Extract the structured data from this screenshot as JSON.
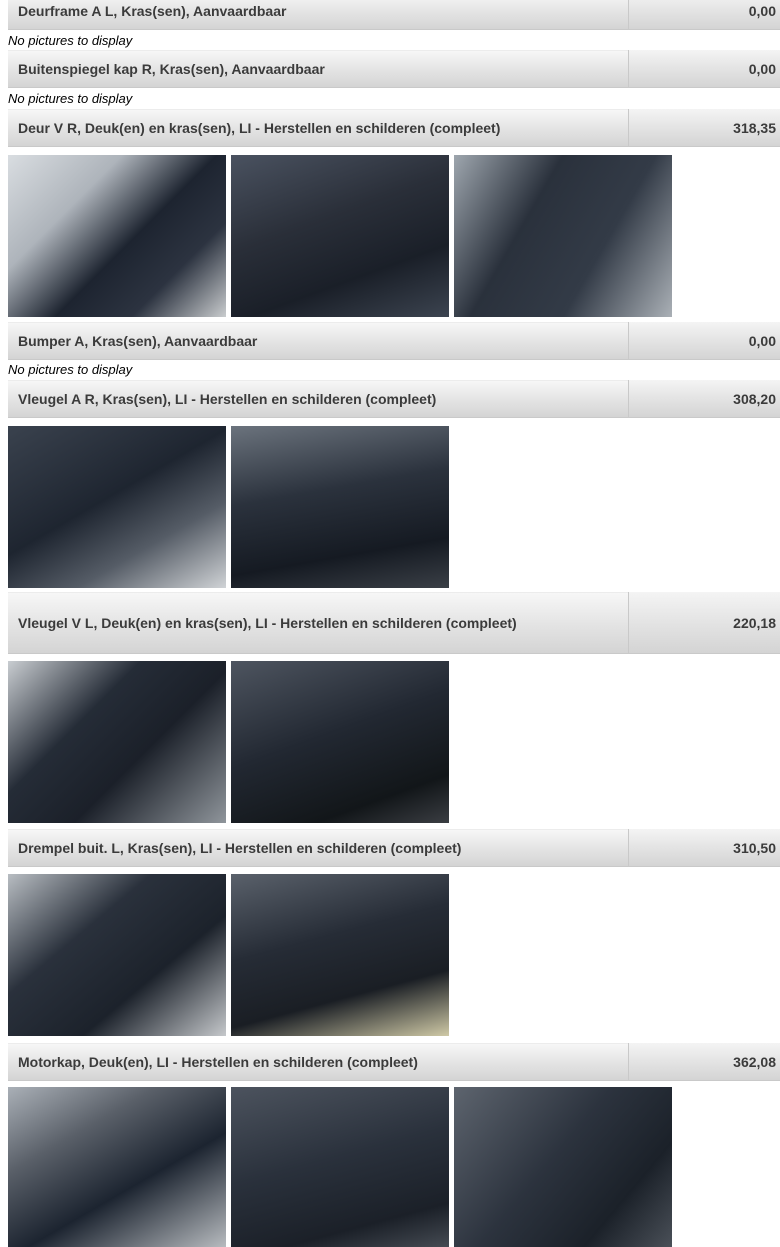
{
  "no_pictures_text": "No pictures to display",
  "items": [
    {
      "label": "Deurframe A L, Kras(sen), Aanvaardbaar",
      "price": "0,00"
    },
    {
      "label": "Buitenspiegel kap R, Kras(sen), Aanvaardbaar",
      "price": "0,00"
    },
    {
      "label": "Deur V R, Deuk(en) en kras(sen), LI - Herstellen en schilderen (compleet)",
      "price": "318,35"
    },
    {
      "label": "Bumper A, Kras(sen), Aanvaardbaar",
      "price": "0,00"
    },
    {
      "label": "Vleugel A R, Kras(sen), LI - Herstellen en schilderen (compleet)",
      "price": "308,20"
    },
    {
      "label": "Vleugel V L, Deuk(en) en kras(sen), LI - Herstellen en schilderen (compleet)",
      "price": "220,18"
    },
    {
      "label": "Drempel buit. L, Kras(sen), LI - Herstellen en schilderen (compleet)",
      "price": "310,50"
    },
    {
      "label": "Motorkap, Deuk(en), LI - Herstellen en schilderen (compleet)",
      "price": "362,08"
    }
  ]
}
